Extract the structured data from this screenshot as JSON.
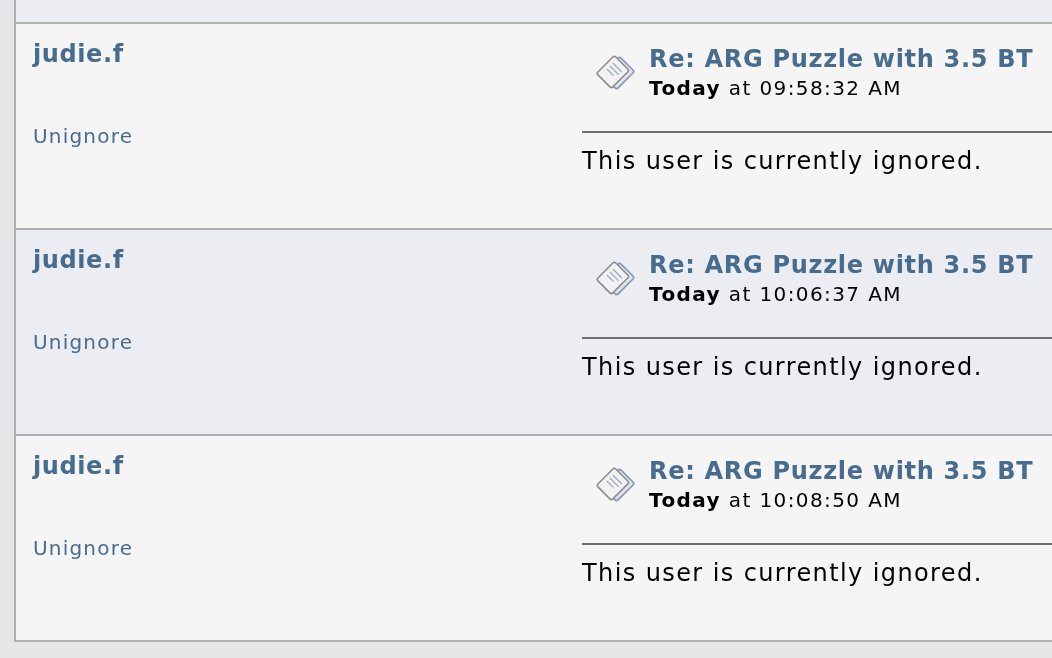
{
  "posts": [
    {
      "author": "judie.f",
      "action_link": "Unignore",
      "title": "Re: ARG Puzzle with 3.5 BT",
      "date": "**Today** at 09:58:32 AM",
      "body": "This user is currently ignored."
    },
    {
      "author": "judie.f",
      "action_link": "Unignore",
      "title": "Re: ARG Puzzle with 3.5 BT",
      "date": "**Today** at 10:06:37 AM",
      "body": "This user is currently ignored."
    },
    {
      "author": "judie.f",
      "action_link": "Unignore",
      "title": "Re: ARG Puzzle with 3.5 BT",
      "date": "**Today** at 10:08:50 AM",
      "body": "This user is currently ignored."
    }
  ]
}
